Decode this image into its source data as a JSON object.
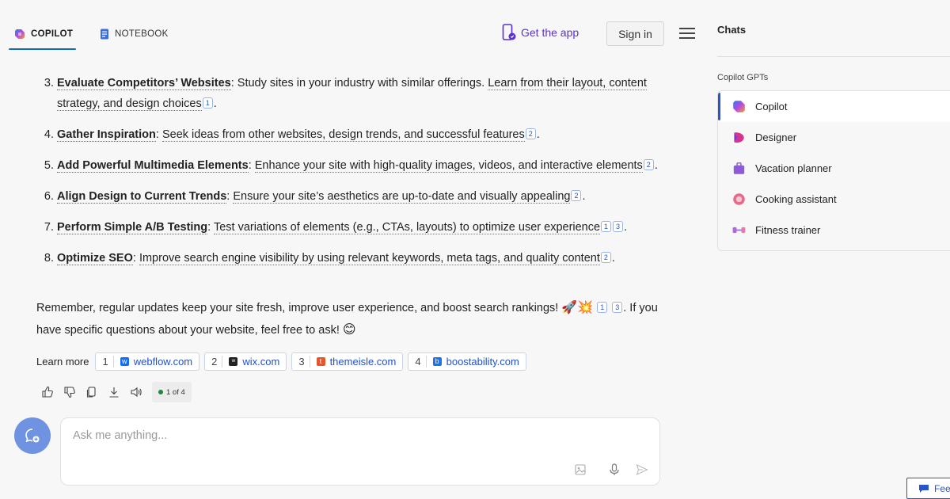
{
  "header": {
    "tabs": [
      {
        "label": "COPILOT",
        "active": true
      },
      {
        "label": "NOTEBOOK",
        "active": false
      }
    ],
    "get_app": "Get the app",
    "sign_in": "Sign in"
  },
  "answer": {
    "points": [
      {
        "num": "3.",
        "title": "Evaluate Competitors’ Websites",
        "sep": ": ",
        "text": "Study sites in your industry with similar offerings. ",
        "text_ul": "Learn from their layout, content strategy, and design choices",
        "cites": [
          "1"
        ],
        "end": "."
      },
      {
        "num": "4.",
        "title": "Gather Inspiration",
        "sep": ": ",
        "text": "",
        "text_ul": "Seek ideas from other websites, design trends, and successful features",
        "cites": [
          "2"
        ],
        "end": "."
      },
      {
        "num": "5.",
        "title": "Add Powerful Multimedia Elements",
        "sep": ": ",
        "text": "",
        "text_ul": "Enhance your site with high-quality images, videos, and interactive elements",
        "cites": [
          "2"
        ],
        "end": "."
      },
      {
        "num": "6.",
        "title": "Align Design to Current Trends",
        "sep": ": ",
        "text": "",
        "text_ul": "Ensure your site’s aesthetics are up-to-date and visually appealing",
        "cites": [
          "2"
        ],
        "end": "."
      },
      {
        "num": "7.",
        "title": "Perform Simple A/B Testing",
        "sep": ": ",
        "text": "",
        "text_ul": "Test variations of elements (e.g., CTAs, layouts) to optimize user experience",
        "cites": [
          "1",
          "3"
        ],
        "end": "."
      },
      {
        "num": "8.",
        "title": "Optimize SEO",
        "sep": ": ",
        "text": "",
        "text_ul": "Improve search engine visibility by using relevant keywords, meta tags, and quality content",
        "cites": [
          "2"
        ],
        "end": "."
      }
    ],
    "remember_text": "Remember, regular updates keep your site fresh, improve user experience, and boost search rankings! ",
    "remember_emojis": "🚀💥",
    "remember_cites": [
      "1",
      "3"
    ],
    "remember_text2": ". If you have specific questions about your website, feel free to ask! ",
    "remember_emoji2": "😊",
    "learn_more_label": "Learn more",
    "sources": [
      {
        "n": "1",
        "domain": "webflow.com",
        "color": "#146ef5",
        "glyph": "w"
      },
      {
        "n": "2",
        "domain": "wix.com",
        "color": "#222222",
        "glyph": "ʷ"
      },
      {
        "n": "3",
        "domain": "themeisle.com",
        "color": "#e8542b",
        "glyph": "t"
      },
      {
        "n": "4",
        "domain": "boostability.com",
        "color": "#1a73e8",
        "glyph": "b"
      }
    ],
    "pager": "1 of 4"
  },
  "input": {
    "placeholder": "Ask me anything..."
  },
  "sidebar": {
    "title": "Chats",
    "gpts_label": "Copilot GPTs",
    "gpts": [
      {
        "label": "Copilot",
        "icon": "copilot-icon",
        "active": true
      },
      {
        "label": "Designer",
        "icon": "designer-icon",
        "active": false
      },
      {
        "label": "Vacation planner",
        "icon": "suitcase-icon",
        "active": false
      },
      {
        "label": "Cooking assistant",
        "icon": "cooking-icon",
        "active": false
      },
      {
        "label": "Fitness trainer",
        "icon": "dumbbell-icon",
        "active": false
      }
    ]
  },
  "feedback_label": "Fee",
  "colors": {
    "accent": "#2a55c9",
    "tab_underline": "#0f6cbd",
    "get_app": "#5b2fd1",
    "new_chat_button": "#6f93e0"
  }
}
